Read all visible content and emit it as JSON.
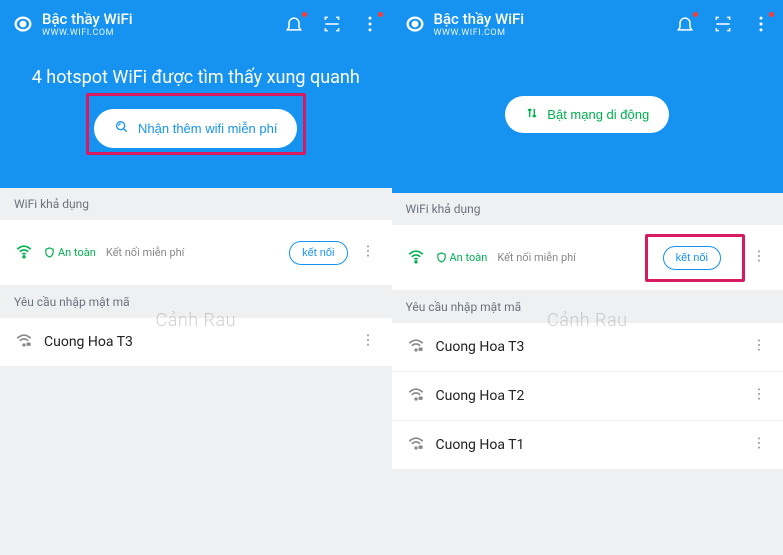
{
  "app": {
    "title": "Bậc thầy WiFi",
    "subtitle": "WWW.WIFI.COM"
  },
  "left": {
    "banner": "4 hotspot WiFi được tìm thấy xung quanh",
    "cta": "Nhận thêm wifi miễn phí",
    "sections": {
      "available": "WiFi khả dụng",
      "password": "Yêu cầu nhập mật mã"
    },
    "safe": "An toàn",
    "free": "Kết nối miễn phí",
    "connect": "kết nối",
    "networks": [
      "Cuong Hoa T3"
    ]
  },
  "right": {
    "cta": "Bật mạng di động",
    "sections": {
      "available": "WiFi khả dụng",
      "password": "Yêu cầu nhập mật mã"
    },
    "safe": "An toàn",
    "free": "Kết nối miễn phí",
    "connect": "kết nối",
    "networks": [
      "Cuong Hoa T3",
      "Cuong Hoa T2",
      "Cuong Hoa T1"
    ]
  },
  "watermark": "Cảnh Rau"
}
